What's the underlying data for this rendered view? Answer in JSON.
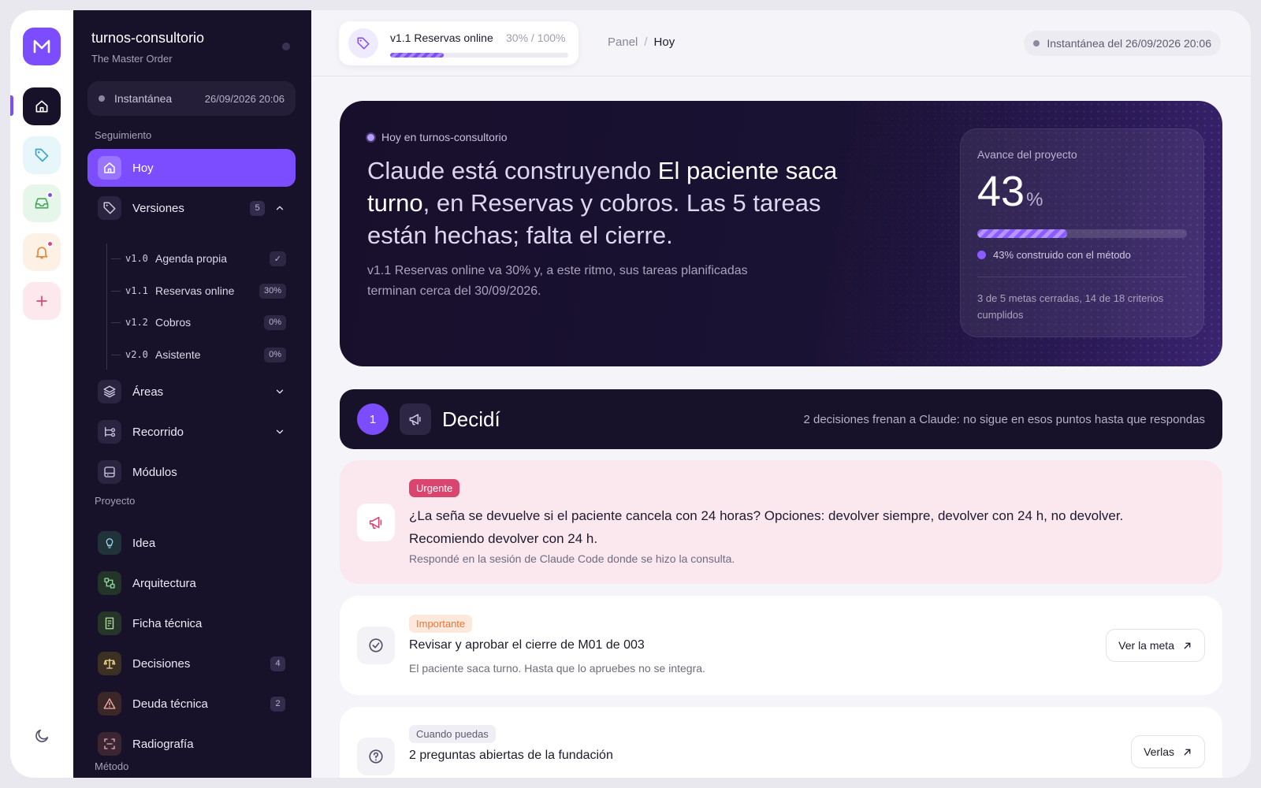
{
  "rail": {
    "logo_letter": "M",
    "items": [
      "home-icon",
      "tag-icon",
      "inbox-icon",
      "bell-icon",
      "plus-icon"
    ],
    "theme_icon": "moon-icon"
  },
  "workspace": {
    "name": "turnos-consultorio",
    "org": "The Master Order",
    "snapshot_label": "Instantánea",
    "snapshot_value": "26/09/2026 20:06"
  },
  "nav": {
    "section_tracking": "Seguimiento",
    "today": "Hoy",
    "versions": "Versiones",
    "versions_count": "5",
    "versions_list": [
      {
        "code": "v1.0",
        "label": "Agenda propia",
        "badge": "✓"
      },
      {
        "code": "v1.1",
        "label": "Reservas online",
        "badge": "30%"
      },
      {
        "code": "v1.2",
        "label": "Cobros",
        "badge": "0%"
      },
      {
        "code": "v2.0",
        "label": "Asistente",
        "badge": "0%"
      }
    ],
    "areas": "Áreas",
    "journey": "Recorrido",
    "modules": "Módulos",
    "section_project": "Proyecto",
    "idea": "Idea",
    "architecture": "Arquitectura",
    "tech_sheet": "Ficha técnica",
    "decisions": "Decisiones",
    "decisions_count": "4",
    "tech_debt": "Deuda técnica",
    "tech_debt_count": "2",
    "xray": "Radiografía",
    "section_method": "Método"
  },
  "topbar": {
    "version_name": "v1.1 Reservas online",
    "version_progress": "30% / 100%",
    "version_progress_value": 30,
    "breadcrumb_root": "Panel",
    "breadcrumb_sep": "/",
    "breadcrumb_current": "Hoy",
    "snapshot": "Instantánea del 26/09/2026 20:06"
  },
  "hero": {
    "kicker": "Hoy en turnos-consultorio",
    "headline_pre": "Claude está construyendo ",
    "headline_hl": "El paciente saca turno",
    "headline_post": ", en Reservas y cobros. Las 5 tareas están hechas; falta el cierre.",
    "subtitle": "v1.1 Reservas online va 30% y, a este ritmo, sus tareas planificadas terminan cerca del 30/09/2026.",
    "progress_label": "Avance del proyecto",
    "progress_value": "43",
    "progress_unit": "%",
    "progress_fraction": 43,
    "progress_legend": "43% construido con el método",
    "progress_note": "3 de 5 metas cerradas, 14 de 18 criterios cumplidos"
  },
  "decide": {
    "number": "1",
    "title": "Decidí",
    "summary": "2 decisiones frenan a Claude: no sigue en esos puntos hasta que respondas"
  },
  "cards": [
    {
      "tag": "Urgente",
      "title": "¿La seña se devuelve si el paciente cancela con 24 horas? Opciones: devolver siempre, devolver con 24 h, no devolver. Recomiendo devolver con 24 h.",
      "desc": "Respondé en la sesión de Claude Code donde se hizo la consulta."
    },
    {
      "tag": "Importante",
      "title": "Revisar y aprobar el cierre de M01 de 003",
      "desc": "El paciente saca turno. Hasta que lo apruebes no se integra.",
      "button": "Ver la meta"
    },
    {
      "tag": "Cuando puedas",
      "title": "2 preguntas abiertas de la fundación",
      "button": "Verlas"
    }
  ],
  "colors": {
    "accent": "#7c4dff",
    "sidebar_bg": "#171129",
    "urgent": "#d9456f",
    "important": "#e8763a"
  }
}
